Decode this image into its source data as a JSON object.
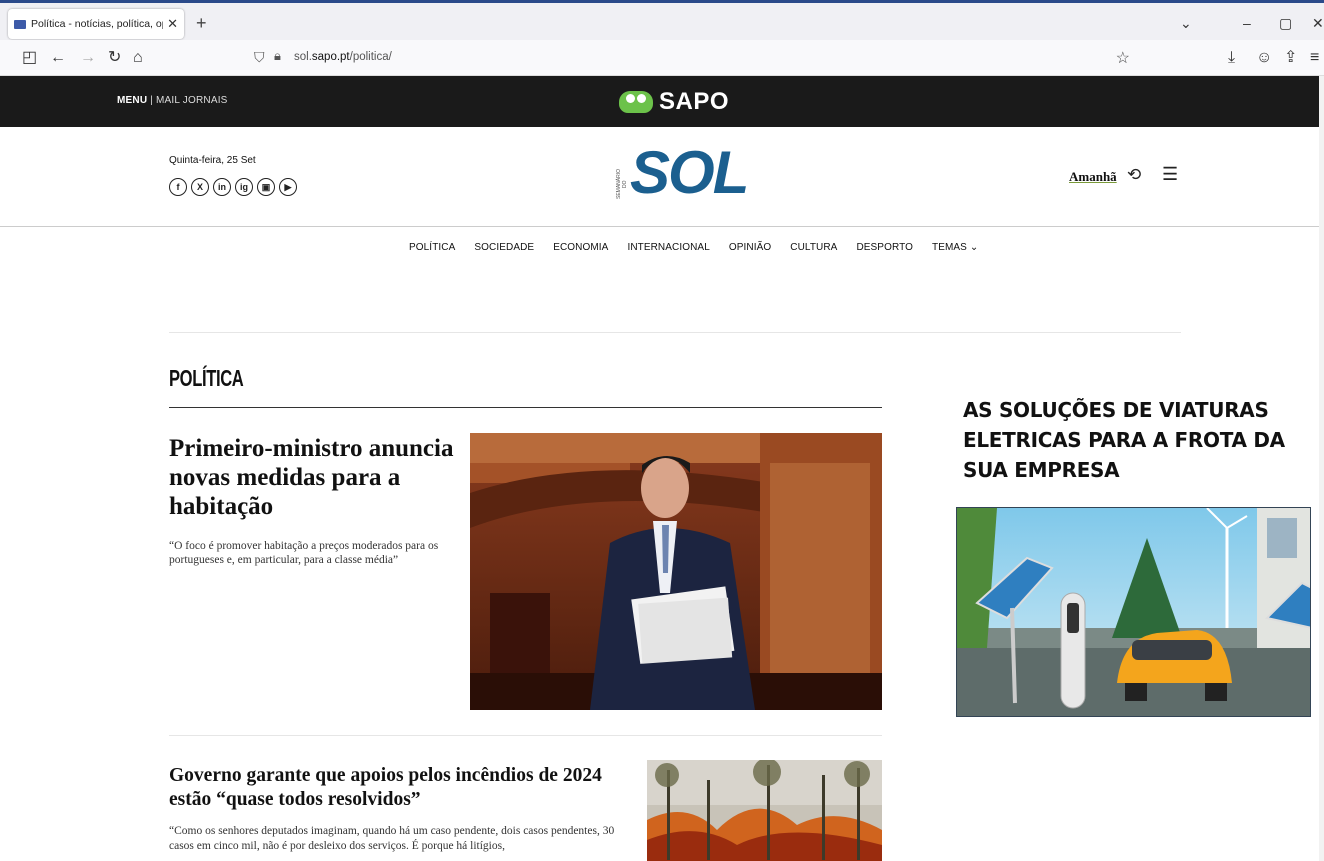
{
  "browser": {
    "tab_title": "Política - notícias, política, opini",
    "url_prefix": "sol.",
    "url_domain": "sapo.pt",
    "url_path": "/politica/"
  },
  "sapo_bar": {
    "menu_label": "MENU",
    "separator": "|",
    "mail_label": "MAIL",
    "jornais_label": "JORNAIS",
    "logo_text": "SAPO"
  },
  "header": {
    "date": "Quinta-feira, 25 Set",
    "logo_pre": "SEMANÁRIO DO",
    "logo_text": "SOL",
    "amanha_label": "Amanhã",
    "socials": [
      "f",
      "X",
      "in",
      "ig",
      "▣",
      "▶"
    ]
  },
  "nav": {
    "items": [
      "POLÍTICA",
      "SOCIEDADE",
      "ECONOMIA",
      "INTERNACIONAL",
      "OPINIÃO",
      "CULTURA",
      "DESPORTO",
      "TEMAS ⌄"
    ]
  },
  "section": {
    "title": "POLÍTICA"
  },
  "articles": [
    {
      "title": "Primeiro-ministro anuncia novas medidas para a habitação",
      "lead": "“O foco é promover habitação a preços moderados para os portugueses e, em particular, para a classe média”"
    },
    {
      "title": "Governo garante que apoios pelos incêndios de 2024 estão “quase todos resolvidos”",
      "lead": "“Como os senhores deputados imaginam, quando há um caso pendente, dois casos pendentes, 30 casos em cinco mil, não é por desleixo dos serviços. É porque há litígios,"
    }
  ],
  "ad": {
    "title": "AS SOLUÇÕES DE VIATURAS ELETRICAS PARA A FROTA DA SUA EMPRESA"
  },
  "colors": {
    "sol_blue": "#1b5f8f",
    "sapo_green": "#6cc24a",
    "sapo_bar_bg": "#1a1a1a"
  }
}
